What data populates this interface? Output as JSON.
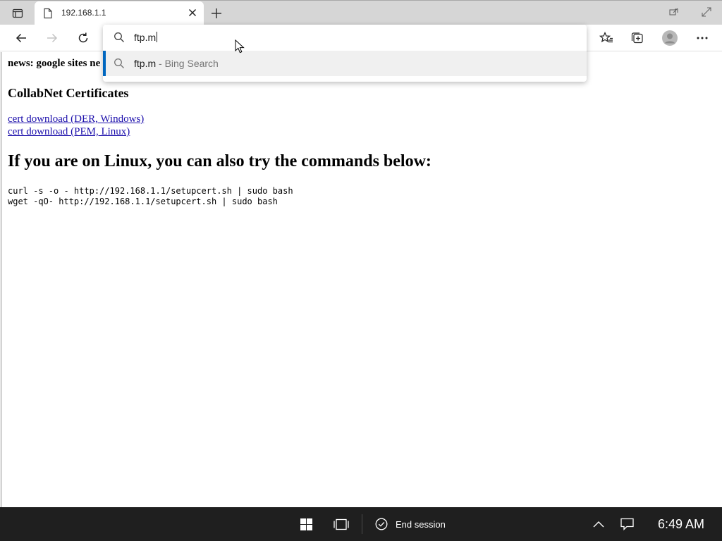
{
  "browser": {
    "tab": {
      "title": "192.168.1.1"
    },
    "address_bar": {
      "value": "ftp.m"
    },
    "suggestions": [
      {
        "text": "ftp.m",
        "suffix": " - Bing Search"
      }
    ]
  },
  "page": {
    "news_text": "news: google sites ne",
    "heading_certs": "CollabNet Certificates",
    "links": [
      "cert download (DER, Windows)",
      "cert download (PEM, Linux)"
    ],
    "heading_linux": "If you are on Linux, you can also try the commands below:",
    "commands": [
      "curl -s -o - http://192.168.1.1/setupcert.sh | sudo bash",
      "wget -qO- http://192.168.1.1/setupcert.sh | sudo bash"
    ]
  },
  "taskbar": {
    "end_session": "End session",
    "clock": "6:49 AM"
  },
  "colors": {
    "link": "#1a0dab",
    "accent": "#0067c0",
    "taskbar": "#1f1f1f"
  },
  "icons": [
    "tab-actions-icon",
    "page-icon",
    "close-icon",
    "plus-icon",
    "back-icon",
    "forward-icon",
    "refresh-icon",
    "search-icon",
    "favorites-icon",
    "collections-icon",
    "profile-icon",
    "more-icon",
    "windows-start-icon",
    "task-view-icon",
    "check-circle-icon",
    "chevron-up-icon",
    "notification-icon"
  ]
}
